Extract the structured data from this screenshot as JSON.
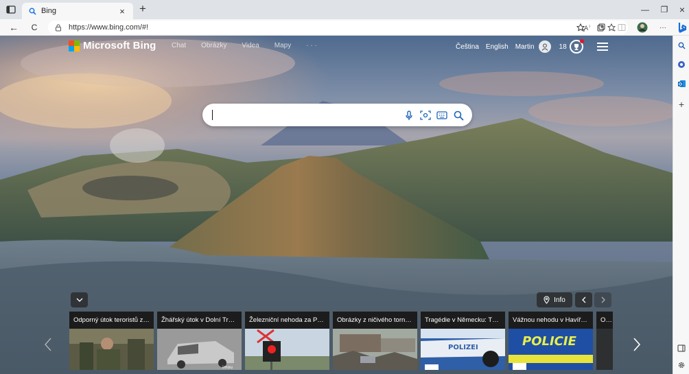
{
  "browser": {
    "tab": {
      "title": "Bing",
      "close": "×"
    },
    "new_tab": "+",
    "window": {
      "minimize": "—",
      "restore": "❐",
      "close": "×"
    },
    "nav": {
      "back": "←",
      "refresh": "C"
    },
    "url": "https://www.bing.com/#!",
    "toolbar_icons": [
      "read-aloud-icon",
      "add-favorite-icon",
      "favorites-icon",
      "collections-icon",
      "split-screen-icon",
      "profile-icon",
      "more-icon"
    ],
    "more": "···"
  },
  "edge_sidebar": {
    "items": [
      "search-icon",
      "shopping-icon",
      "outlook-icon",
      "add-icon"
    ],
    "add": "+"
  },
  "bing": {
    "logo_text": "Microsoft Bing",
    "nav": [
      "Chat",
      "Obrázky",
      "Videa",
      "Mapy",
      "· · ·"
    ],
    "language_cz": "Čeština",
    "language_en": "English",
    "user_name": "Martin",
    "rewards_count": "18",
    "search": {
      "value": "",
      "placeholder": ""
    },
    "info_label": "Info",
    "news": [
      {
        "title": "Odporný útok teroristů zab...",
        "thumb": "soldiers-photo"
      },
      {
        "title": "Žhářský útok v Dolní Trnáv...",
        "thumb": "burned-car-photo"
      },
      {
        "title": "Železniční nehoda za Prah...",
        "thumb": "railway-crossing-photo"
      },
      {
        "title": "Obrázky z ničivého tornáda...",
        "thumb": "tornado-damage-photo"
      },
      {
        "title": "Tragédie v Německu: Těžká...",
        "thumb": "polizei-car-photo"
      },
      {
        "title": "Vážnou nehodu v Havířově...",
        "thumb": "policie-car-photo"
      },
      {
        "title": "ON-",
        "thumb": "yellow-photo"
      }
    ]
  },
  "colors": {
    "bing_accent": "#0078d4",
    "ms_red": "#f25022",
    "ms_green": "#7fba00",
    "ms_blue": "#00a4ef",
    "ms_yellow": "#ffb900",
    "notification": "#e81123"
  }
}
